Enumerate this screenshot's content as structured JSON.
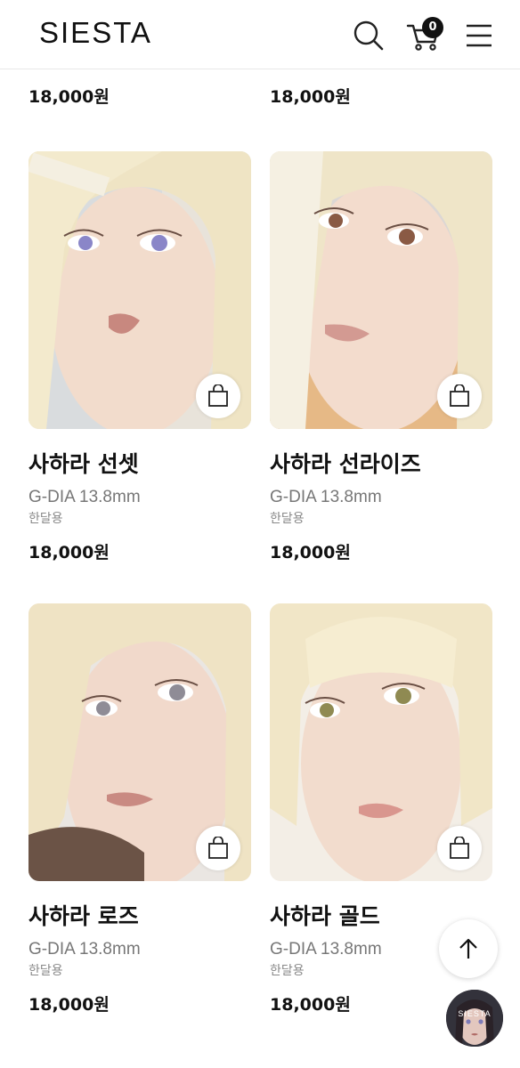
{
  "header": {
    "logo": "SIESTA",
    "cart_count": "0",
    "search_icon": "search-icon",
    "cart_icon": "cart-icon",
    "menu_icon": "hamburger-menu-icon"
  },
  "top_row": {
    "left_price": "18,000원",
    "right_price": "18,000원"
  },
  "products": [
    {
      "name": "사하라 선셋",
      "spec": "G-DIA 13.8mm",
      "period": "한달용",
      "price": "18,000원",
      "eye_color": "#8a86c8"
    },
    {
      "name": "사하라 선라이즈",
      "spec": "G-DIA 13.8mm",
      "period": "한달용",
      "price": "18,000원",
      "eye_color": "#8a5a44"
    },
    {
      "name": "사하라 로즈",
      "spec": "G-DIA 13.8mm",
      "period": "한달용",
      "price": "18,000원",
      "eye_color": "#8f8c96"
    },
    {
      "name": "사하라 골드",
      "spec": "G-DIA 13.8mm",
      "period": "한달용",
      "price": "18,000원",
      "eye_color": "#8f8a52"
    }
  ],
  "floating": {
    "scroll_top_icon": "arrow-up-icon",
    "chat_label": "SIESTA"
  },
  "colors": {
    "text": "#111111",
    "muted": "#777777",
    "hair": "#efe3c2",
    "skin": "#f1d9c8"
  }
}
